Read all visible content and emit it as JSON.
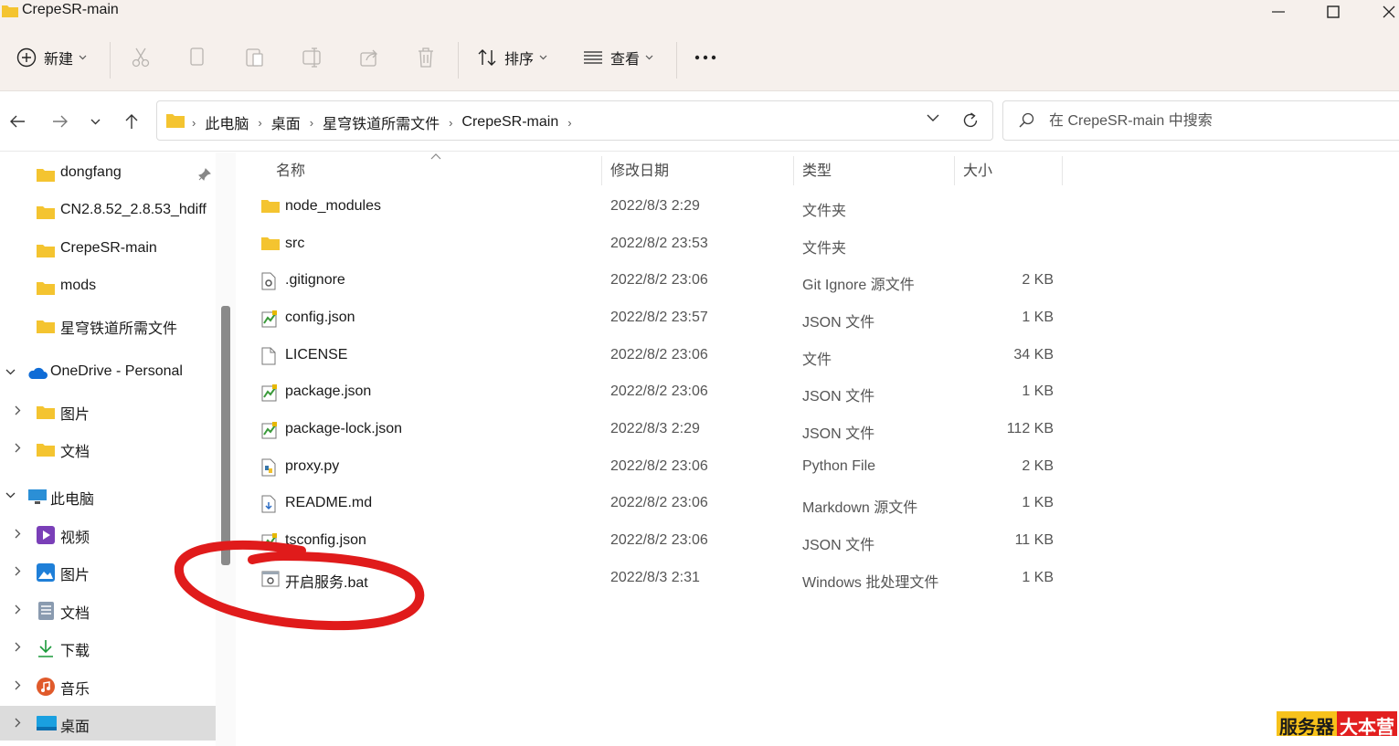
{
  "window": {
    "title": "CrepeSR-main"
  },
  "toolbar": {
    "new_label": "新建",
    "sort_label": "排序",
    "view_label": "查看"
  },
  "address": {
    "breadcrumbs": [
      "此电脑",
      "桌面",
      "星穹铁道所需文件",
      "CrepeSR-main"
    ]
  },
  "search": {
    "placeholder": "在 CrepeSR-main 中搜索"
  },
  "sidebar": {
    "quick_access": [
      "dongfang",
      "CN2.8.52_2.8.53_hdiff",
      "CrepeSR-main",
      "mods",
      "星穹铁道所需文件"
    ],
    "onedrive": {
      "label": "OneDrive - Personal",
      "children": [
        "图片",
        "文档"
      ]
    },
    "this_pc": {
      "label": "此电脑",
      "children": [
        "视频",
        "图片",
        "文档",
        "下载",
        "音乐",
        "桌面"
      ]
    }
  },
  "columns": {
    "name": "名称",
    "date": "修改日期",
    "type": "类型",
    "size": "大小"
  },
  "files": [
    {
      "name": "node_modules",
      "date": "2022/8/3 2:29",
      "type": "文件夹",
      "size": "",
      "icon": "folder-icon"
    },
    {
      "name": "src",
      "date": "2022/8/2 23:53",
      "type": "文件夹",
      "size": "",
      "icon": "folder-icon"
    },
    {
      "name": ".gitignore",
      "date": "2022/8/2 23:06",
      "type": "Git Ignore 源文件",
      "size": "2 KB",
      "icon": "config-file-icon"
    },
    {
      "name": "config.json",
      "date": "2022/8/2 23:57",
      "type": "JSON 文件",
      "size": "1 KB",
      "icon": "json-file-icon"
    },
    {
      "name": "LICENSE",
      "date": "2022/8/2 23:06",
      "type": "文件",
      "size": "34 KB",
      "icon": "blank-file-icon"
    },
    {
      "name": "package.json",
      "date": "2022/8/2 23:06",
      "type": "JSON 文件",
      "size": "1 KB",
      "icon": "json-file-icon"
    },
    {
      "name": "package-lock.json",
      "date": "2022/8/3 2:29",
      "type": "JSON 文件",
      "size": "112 KB",
      "icon": "json-file-icon"
    },
    {
      "name": "proxy.py",
      "date": "2022/8/2 23:06",
      "type": "Python File",
      "size": "2 KB",
      "icon": "python-file-icon"
    },
    {
      "name": "README.md",
      "date": "2022/8/2 23:06",
      "type": "Markdown 源文件",
      "size": "1 KB",
      "icon": "markdown-file-icon"
    },
    {
      "name": "tsconfig.json",
      "date": "2022/8/2 23:06",
      "type": "JSON 文件",
      "size": "11 KB",
      "icon": "json-file-icon"
    },
    {
      "name": "开启服务.bat",
      "date": "2022/8/3 2:31",
      "type": "Windows 批处理文件",
      "size": "1 KB",
      "icon": "batch-file-icon"
    }
  ],
  "watermark": {
    "part1": "服务器",
    "part2": "大本营"
  },
  "colors": {
    "folder": "#f4c430",
    "titlebar": "#f6f0ec",
    "annotation": "#e01b1b",
    "selected": "#dcdcdc"
  }
}
